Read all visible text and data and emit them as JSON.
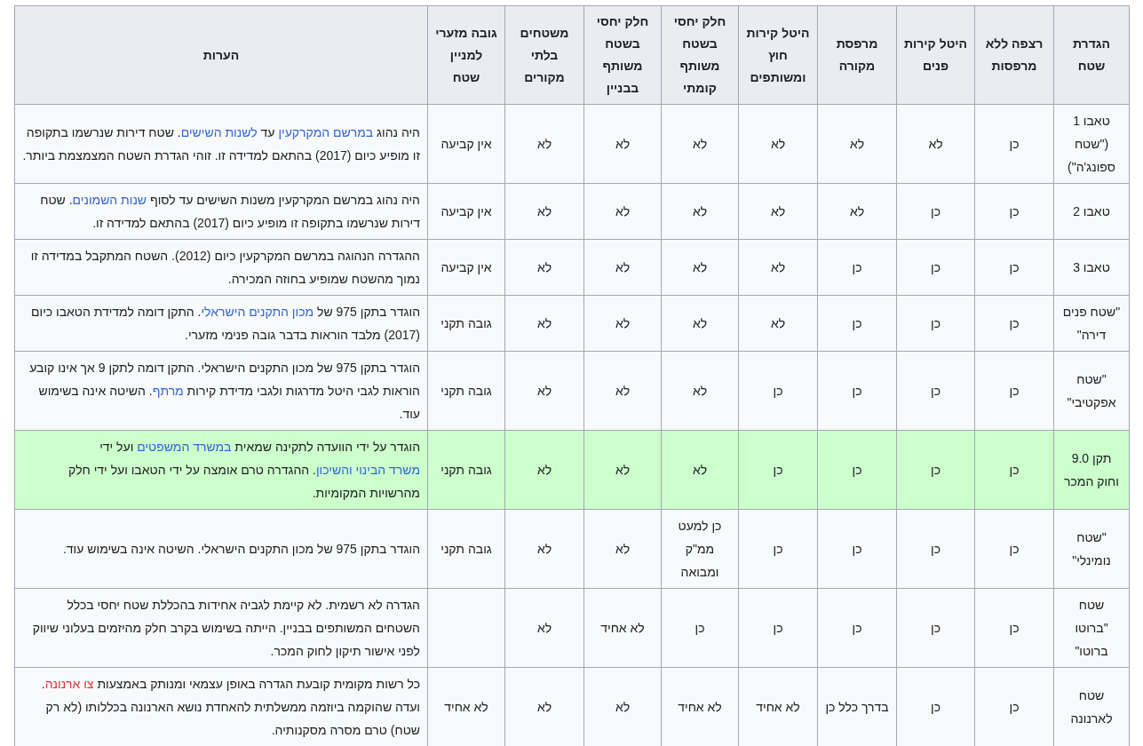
{
  "table": {
    "columns": [
      "הגדרת שטח",
      "רצפה ללא מרפסות",
      "היטל קירות פנים",
      "מרפסת מקורה",
      "היטל קירות חוץ ומשותפים",
      "חלק יחסי בשטח משותף קומתי",
      "חלק יחסי בשטח משותף בבניין",
      "משטחים בלתי מקורים",
      "גובה מזערי למניין שטח",
      "הערות"
    ],
    "rows": [
      {
        "highlighted": false,
        "definition": "טאבו 1 (\"שטח ספונג'ה\")",
        "values": [
          "כן",
          "לא",
          "לא",
          "לא",
          "לא",
          "לא",
          "לא",
          "אין קביעה"
        ],
        "notes": [
          {
            "kind": "plain",
            "text": "היה נהוג "
          },
          {
            "kind": "link",
            "text": "במרשם המקרקעין"
          },
          {
            "kind": "plain",
            "text": " עד "
          },
          {
            "kind": "link",
            "text": "לשנות השישים"
          },
          {
            "kind": "plain",
            "text": ". שטח דירות שנרשמו בתקופה זו מופיע כיום (2017) בהתאם למדידה זו. זוהי הגדרת השטח המצמצמת ביותר."
          }
        ]
      },
      {
        "highlighted": false,
        "definition": "טאבו 2",
        "values": [
          "כן",
          "כן",
          "לא",
          "לא",
          "לא",
          "לא",
          "לא",
          "אין קביעה"
        ],
        "notes": [
          {
            "kind": "plain",
            "text": "היה נהוג במרשם המקרקעין משנות השישים עד לסוף "
          },
          {
            "kind": "link",
            "text": "שנות השמונים"
          },
          {
            "kind": "plain",
            "text": ". שטח דירות שנרשמו בתקופה זו מופיע כיום (2017) בהתאם למדידה זו."
          }
        ]
      },
      {
        "highlighted": false,
        "definition": "טאבו 3",
        "values": [
          "כן",
          "כן",
          "כן",
          "לא",
          "לא",
          "לא",
          "לא",
          "אין קביעה"
        ],
        "notes": [
          {
            "kind": "plain",
            "text": "ההגדרה הנהוגה במרשם המקרקעין כיום (2012). השטח המתקבל במדידה זו נמוך מהשטח שמופיע בחוזה המכירה."
          }
        ]
      },
      {
        "highlighted": false,
        "definition": "\"שטח פנים דירה\"",
        "values": [
          "כן",
          "כן",
          "כן",
          "לא",
          "לא",
          "לא",
          "לא",
          "גובה תקני"
        ],
        "notes": [
          {
            "kind": "plain",
            "text": "הוגדר בתקן 975 של "
          },
          {
            "kind": "link",
            "text": "מכון התקנים הישראלי"
          },
          {
            "kind": "plain",
            "text": ". התקן דומה למדידת הטאבו כיום (2017) מלבד הוראות בדבר גובה פנימי מזערי."
          }
        ]
      },
      {
        "highlighted": false,
        "definition": "\"שטח אפקטיבי\"",
        "values": [
          "כן",
          "כן",
          "כן",
          "כן",
          "לא",
          "לא",
          "לא",
          "גובה תקני"
        ],
        "notes": [
          {
            "kind": "plain",
            "text": "הוגדר בתקן 975 של מכון התקנים הישראלי. התקן דומה לתקן 9 אך אינו קובע הוראות לגבי היטל מדרגות ולגבי מדידת קירות "
          },
          {
            "kind": "link",
            "text": "מרתף"
          },
          {
            "kind": "plain",
            "text": ". השיטה אינה בשימוש עוד."
          }
        ]
      },
      {
        "highlighted": true,
        "definition": "תקן 9.0 וחוק המכר",
        "values": [
          "כן",
          "כן",
          "כן",
          "כן",
          "לא",
          "לא",
          "לא",
          "גובה תקני"
        ],
        "notes": [
          {
            "kind": "plain",
            "text": "הוגדר על ידי הוועדה לתקינה שמאית "
          },
          {
            "kind": "link",
            "text": "במשרד המשפטים"
          },
          {
            "kind": "plain",
            "text": " ועל ידי "
          },
          {
            "kind": "link",
            "text": "משרד הבינוי והשיכון"
          },
          {
            "kind": "plain",
            "text": ". ההגדרה טרם אומצה על ידי הטאבו ועל ידי חלק מהרשויות המקומיות."
          }
        ]
      },
      {
        "highlighted": false,
        "definition": "\"שטח נומינלי\"",
        "values": [
          "כן",
          "כן",
          "כן",
          "כן",
          "כן למעט ממ\"ק ומבואה",
          "לא",
          "לא",
          "גובה תקני"
        ],
        "notes": [
          {
            "kind": "plain",
            "text": "הוגדר בתקן 975 של מכון התקנים הישראלי. השיטה אינה בשימוש עוד."
          }
        ]
      },
      {
        "highlighted": false,
        "definition": "שטח \"ברוטו ברוטו\"",
        "values": [
          "כן",
          "כן",
          "כן",
          "כן",
          "כן",
          "לא אחיד",
          "לא"
        ],
        "notes": [
          {
            "kind": "plain",
            "text": "הגדרה לא רשמית. לא קיימת לגביה אחידות בהכללת שטח יחסי בכלל השטחים המשותפים בבניין. הייתה בשימוש בקרב חלק מהיזמים בעלוני שיווק לפני אישור תיקון לחוק המכר."
          }
        ]
      },
      {
        "highlighted": false,
        "definition": "שטח לארנונה",
        "values": [
          "כן",
          "כן",
          "בדרך כלל כן",
          "לא אחיד",
          "לא אחיד",
          "לא",
          "לא",
          "לא אחיד"
        ],
        "notes": [
          {
            "kind": "plain",
            "text": "כל רשות מקומית קובעת הגדרה באופן עצמאי ומנותק באמצעות "
          },
          {
            "kind": "redlink",
            "text": "צו ארנונה"
          },
          {
            "kind": "plain",
            "text": ". ועדה שהוקמה ביוזמה ממשלתית להאחדת נושא הארנונה בכללותו (לא רק שטח) טרם מסרה מסקנותיה."
          }
        ]
      }
    ]
  }
}
